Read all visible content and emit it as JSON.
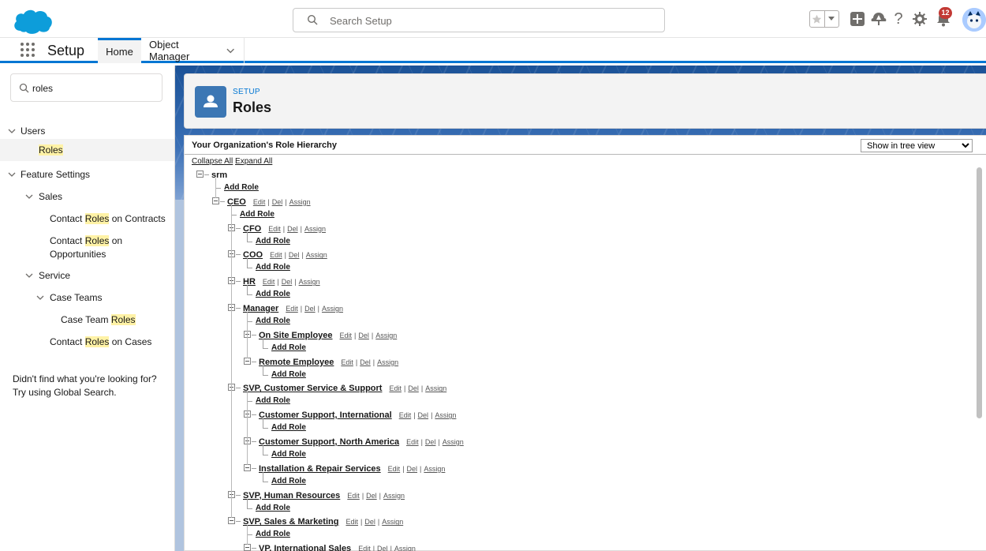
{
  "header": {
    "search_placeholder": "Search Setup",
    "notification_count": "12"
  },
  "context_bar": {
    "app_name": "Setup",
    "tabs": [
      {
        "label": "Home"
      },
      {
        "label": "Object Manager"
      }
    ]
  },
  "sidebar": {
    "search_value": "roles",
    "tree": [
      {
        "label_parts": [
          "Users"
        ],
        "indent": 0,
        "expanded": true
      },
      {
        "label_parts": [
          "",
          "Roles",
          ""
        ],
        "indent": 2,
        "selected": true
      },
      {
        "label_parts": [
          "Feature Settings"
        ],
        "indent": 0,
        "expanded": true
      },
      {
        "label_parts": [
          "Sales"
        ],
        "indent": 1,
        "expanded": true
      },
      {
        "label_parts": [
          "Contact ",
          "Roles",
          " on Contracts"
        ],
        "indent": 2
      },
      {
        "label_parts": [
          "Contact ",
          "Roles",
          " on",
          "Opportunities"
        ],
        "indent": 2
      },
      {
        "label_parts": [
          "Service"
        ],
        "indent": 1,
        "expanded": true
      },
      {
        "label_parts": [
          "Case Teams"
        ],
        "indent": 2,
        "expanded": true
      },
      {
        "label_parts": [
          "Case Team ",
          "Roles",
          ""
        ],
        "indent": 3
      },
      {
        "label_parts": [
          "Contact ",
          "Roles",
          " on Cases"
        ],
        "indent": 2
      }
    ],
    "footer_line1": "Didn't find what you're looking for?",
    "footer_line2": "Try using Global Search."
  },
  "page_header": {
    "eyebrow": "SETUP",
    "title": "Roles"
  },
  "panel": {
    "title": "Your Organization's Role Hierarchy",
    "view_options": [
      "Show in tree view"
    ],
    "collapse_all": "Collapse All",
    "expand_all": "Expand All",
    "actions": {
      "edit": "Edit",
      "del": "Del",
      "assign": "Assign",
      "separator": "|"
    },
    "add_role": "Add Role"
  },
  "role_tree": {
    "name": "srm",
    "children": [
      {
        "name": "CEO",
        "children": [
          {
            "name": "CFO",
            "children": []
          },
          {
            "name": "COO",
            "children": []
          },
          {
            "name": "HR",
            "children": []
          },
          {
            "name": "Manager",
            "children": [
              {
                "name": "On Site Employee",
                "children": []
              },
              {
                "name": "Remote Employee",
                "children": []
              }
            ]
          },
          {
            "name": "SVP, Customer Service & Support",
            "children": [
              {
                "name": "Customer Support, International",
                "children": []
              },
              {
                "name": "Customer Support, North America",
                "children": []
              },
              {
                "name": "Installation & Repair Services",
                "children": []
              }
            ]
          },
          {
            "name": "SVP, Human Resources",
            "children": []
          },
          {
            "name": "SVP, Sales & Marketing",
            "children": [
              {
                "name": "VP, International Sales",
                "children": []
              }
            ]
          }
        ]
      }
    ]
  },
  "colors": {
    "accent": "#0176d3",
    "highlight": "#fff2a6",
    "notification": "#c23934",
    "page_icon": "#3c77b4"
  }
}
